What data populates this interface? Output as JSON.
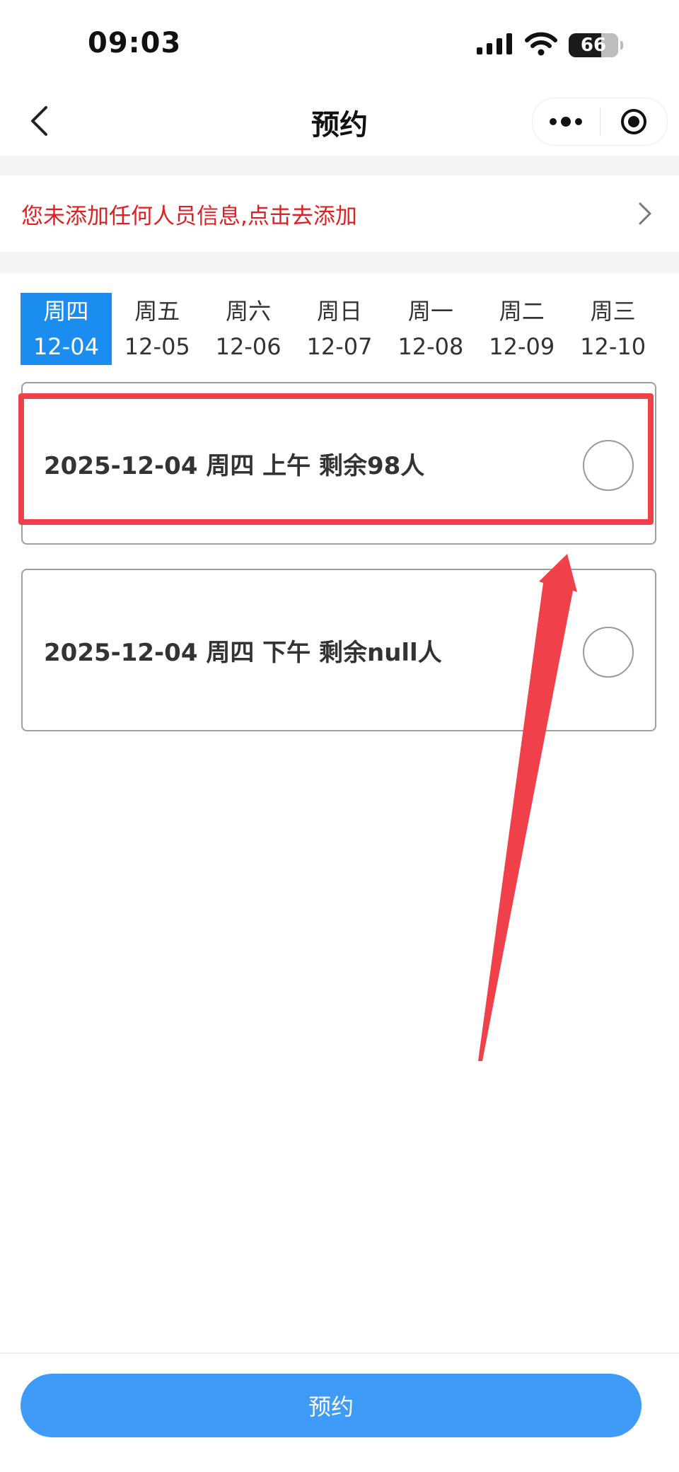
{
  "status_bar": {
    "time": "09:03",
    "battery": "66",
    "icons": [
      "signal-icon",
      "wifi-icon",
      "battery-icon"
    ]
  },
  "nav": {
    "title": "预约",
    "back_icon": "chevron-left-icon",
    "more_icon": "more-dots-icon",
    "close_icon": "target-icon"
  },
  "notice": {
    "text": "您未添加任何人员信息,点击去添加",
    "color": "#e02020",
    "arrow_icon": "chevron-right-icon"
  },
  "date_tabs": [
    {
      "weekday": "周四",
      "date": "12-04",
      "active": true
    },
    {
      "weekday": "周五",
      "date": "12-05",
      "active": false
    },
    {
      "weekday": "周六",
      "date": "12-06",
      "active": false
    },
    {
      "weekday": "周日",
      "date": "12-07",
      "active": false
    },
    {
      "weekday": "周一",
      "date": "12-08",
      "active": false
    },
    {
      "weekday": "周二",
      "date": "12-09",
      "active": false
    },
    {
      "weekday": "周三",
      "date": "12-10",
      "active": false
    }
  ],
  "slots": [
    {
      "label": "2025-12-04 周四 上午 剩余98人",
      "selected": false
    },
    {
      "label": "2025-12-04 周四 下午 剩余null人",
      "selected": false
    }
  ],
  "footer": {
    "button_label": "预约"
  },
  "colors": {
    "accent": "#1b8cf0",
    "button": "#3f9bf8",
    "annotation": "#f0414a"
  }
}
